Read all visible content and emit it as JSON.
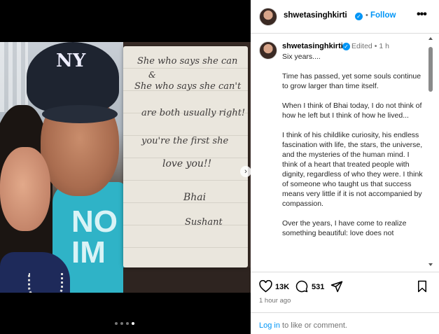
{
  "post": {
    "username": "shwetasinghkirti",
    "separator": "•",
    "follow_label": "Follow",
    "more_label": "•••"
  },
  "media": {
    "carousel_total": 4,
    "carousel_active": 4,
    "cap_logo": "NY",
    "shirt_text": "NO\nIM",
    "note_lines": [
      "She who says  she can",
      "&",
      "She who says she can't",
      "are both usually right!",
      "you're the first she",
      "love you!!",
      "Bhai",
      "Sushant"
    ],
    "next_icon": "chevron-right-icon"
  },
  "caption": {
    "username": "shwetasinghkirti",
    "edited_label": "Edited",
    "separator": "•",
    "time": "1 h",
    "paragraphs": [
      "Six years....",
      "Time has passed, yet some souls continue to grow larger than time itself.",
      "When I think of Bhai today, I do not think of how he left but I think of how he lived...",
      "I think of his childlike curiosity, his endless fascination with life, the stars, the universe, and the mysteries of the human mind. I think of a heart that treated people with dignity, regardless of who they were. I think of someone who taught us that success means very little if it is not accompanied by compassion.",
      "Over the years, I have come to realize something beautiful: love does not"
    ]
  },
  "actions": {
    "likes": "13K",
    "comments": "531"
  },
  "timestamp": "1 hour ago",
  "login": {
    "link_label": "Log in",
    "rest": " to like or comment."
  },
  "colors": {
    "accent": "#0095f6",
    "muted": "#737373",
    "border": "#dbdbdb"
  }
}
